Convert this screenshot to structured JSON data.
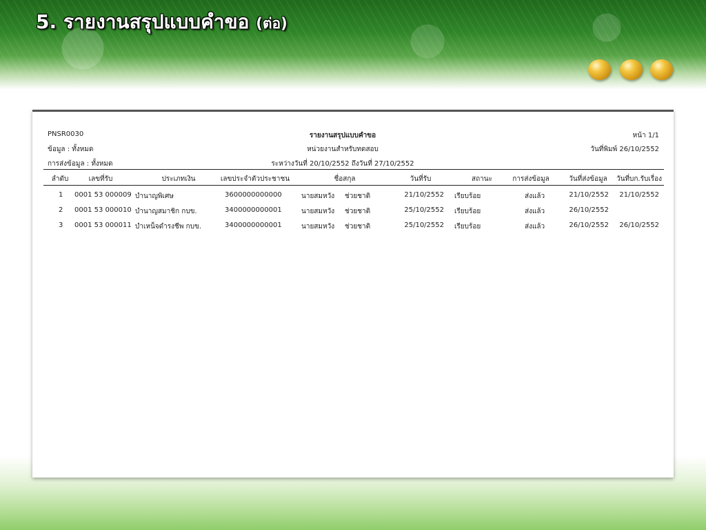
{
  "slide": {
    "title": "5. รายงานสรุปแบบคำขอ",
    "title_suffix": "(ต่อ)"
  },
  "report": {
    "code": "PNSR0030",
    "filter_data": "ข้อมูล : ทั้งหมด",
    "filter_send": "การส่งข้อมูล : ทั้งหมด",
    "title": "รายงานสรุปแบบคำขอ",
    "unit": "หน่วยงานสำหรับทดสอบ",
    "period": "ระหว่างวันที่ 20/10/2552 ถึงวันที่ 27/10/2552",
    "page": "หน้า 1/1",
    "print_date": "วันที่พิมพ์ 26/10/2552",
    "headers": [
      "ลำดับ",
      "เลขที่รับ",
      "ประเภทเงิน",
      "เลขประจำตัวประชาชน",
      "ชื่อสกุล",
      "วันที่รับ",
      "สถานะ",
      "การส่งข้อมูล",
      "วันที่ส่งข้อมูล",
      "วันที่บก.รับเรื่อง"
    ],
    "rows": [
      {
        "no": "1",
        "receipt": "0001 53 000009",
        "type": "บำนาญพิเศษ",
        "id": "3600000000000",
        "first": "นายสมหวัง",
        "last": "ช่วยชาติ",
        "received": "21/10/2552",
        "status": "เรียบร้อย",
        "send": "ส่งแล้ว",
        "sent_date": "21/10/2552",
        "ack_date": "21/10/2552"
      },
      {
        "no": "2",
        "receipt": "0001 53 000010",
        "type": "บำนาญสมาชิก กบข.",
        "id": "3400000000001",
        "first": "นายสมหวัง",
        "last": "ช่วยชาติ",
        "received": "25/10/2552",
        "status": "เรียบร้อย",
        "send": "ส่งแล้ว",
        "sent_date": "26/10/2552",
        "ack_date": ""
      },
      {
        "no": "3",
        "receipt": "0001 53 000011",
        "type": "บำเหน็จดำรงชีพ กบข.",
        "id": "3400000000001",
        "first": "นายสมหวัง",
        "last": "ช่วยชาติ",
        "received": "25/10/2552",
        "status": "เรียบร้อย",
        "send": "ส่งแล้ว",
        "sent_date": "26/10/2552",
        "ack_date": "26/10/2552"
      }
    ]
  },
  "colors": {
    "banner_green": "#2f8428",
    "report_border": "#555555",
    "bullet_gold": "#d29515"
  }
}
